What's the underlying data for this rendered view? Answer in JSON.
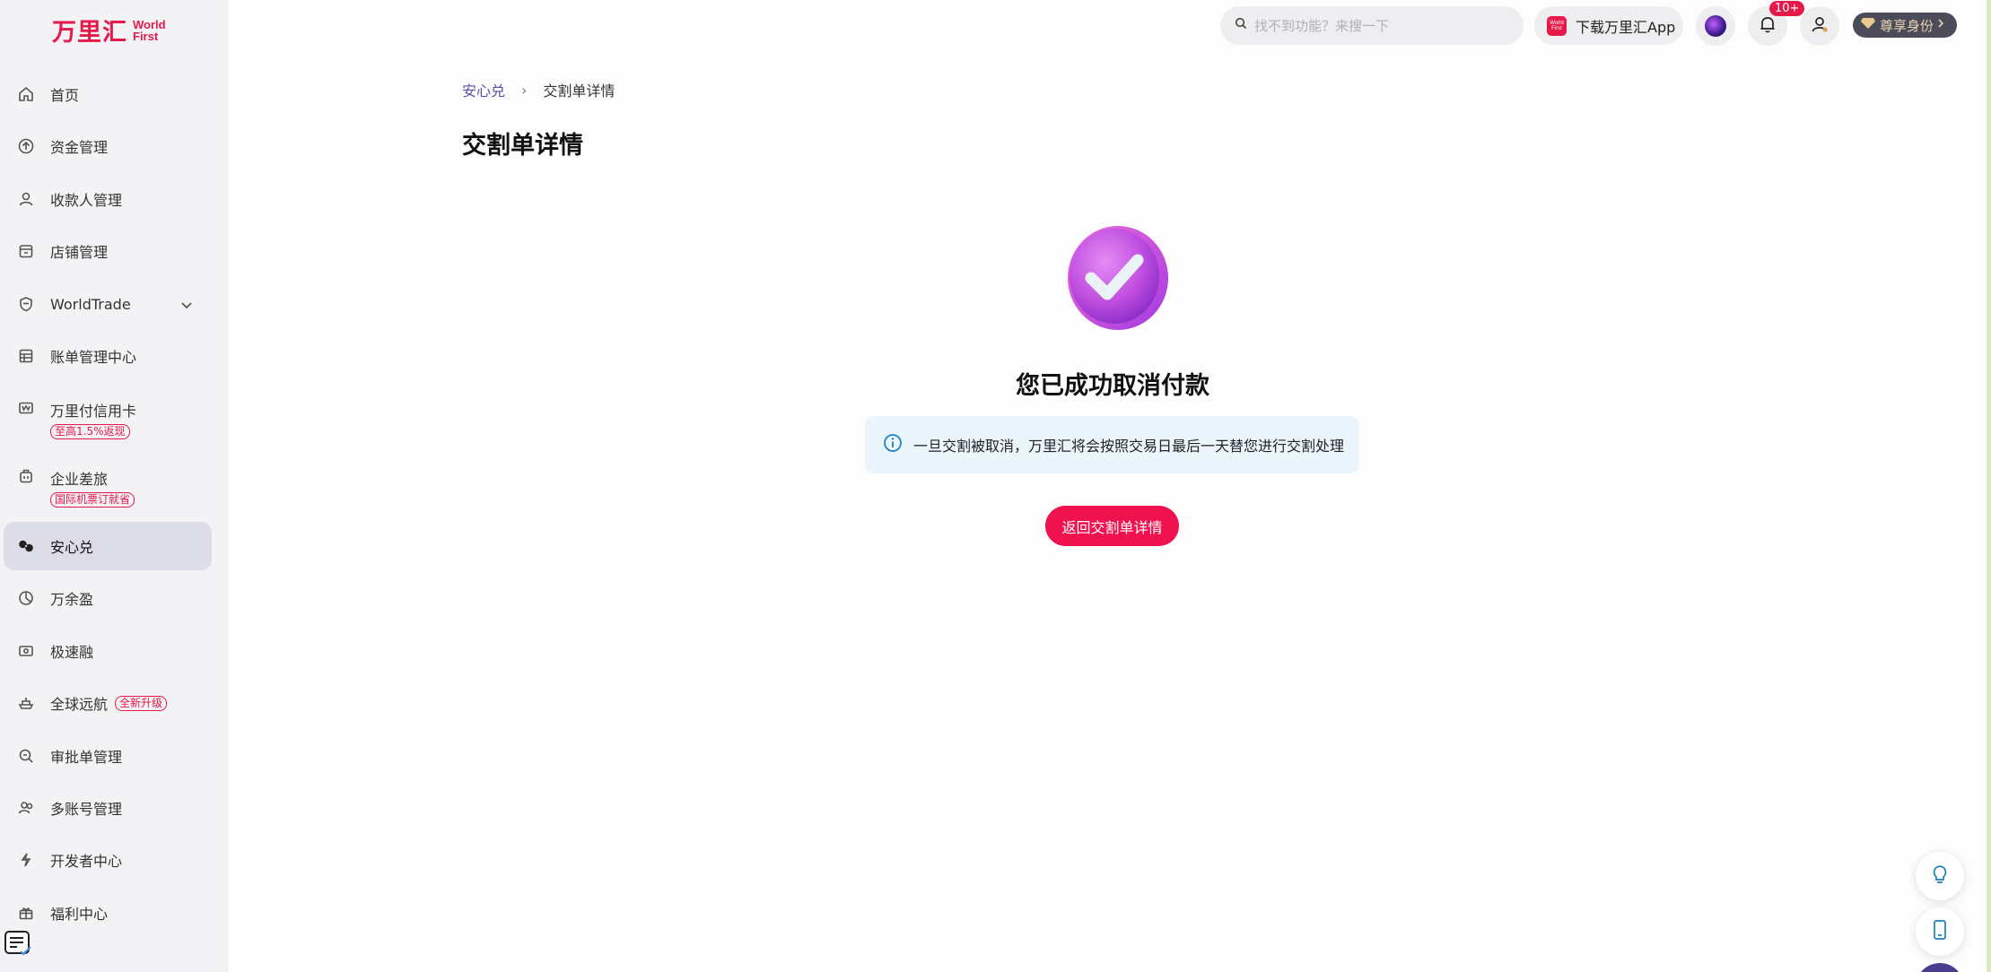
{
  "logo": {
    "cn": "万里汇",
    "en_line1": "World",
    "en_line2": "First"
  },
  "sidebar": {
    "items": [
      {
        "label": "首页",
        "icon": "home-icon"
      },
      {
        "label": "资金管理",
        "icon": "upload-circle-icon"
      },
      {
        "label": "收款人管理",
        "icon": "person-icon"
      },
      {
        "label": "店铺管理",
        "icon": "store-icon"
      },
      {
        "label": "WorldTrade",
        "icon": "shield-icon"
      },
      {
        "label": "账单管理中心",
        "icon": "table-icon"
      },
      {
        "label": "万里付信用卡",
        "badge": "至高1.5%返现",
        "icon": "card-icon"
      },
      {
        "label": "企业差旅",
        "badge": "国际机票订就省",
        "icon": "luggage-icon"
      },
      {
        "label": "安心兑",
        "icon": "exchange-icon"
      },
      {
        "label": "万余盈",
        "icon": "chart-icon"
      },
      {
        "label": "极速融",
        "icon": "money-icon"
      },
      {
        "label": "全球远航",
        "badge": "全新升级",
        "icon": "ship-icon"
      },
      {
        "label": "审批单管理",
        "icon": "search-doc-icon"
      },
      {
        "label": "多账号管理",
        "icon": "users-icon"
      },
      {
        "label": "开发者中心",
        "icon": "code-icon"
      },
      {
        "label": "福利中心",
        "icon": "gift-icon"
      }
    ]
  },
  "topbar": {
    "search_placeholder": "找不到功能？来搜一下",
    "download_label": "下载万里汇App",
    "app_icon_text": "World First",
    "notification_count": "10+",
    "vip_label": "尊享身份"
  },
  "breadcrumb": {
    "parent": "安心兑",
    "separator": "›",
    "current": "交割单详情"
  },
  "page": {
    "title": "交割单详情",
    "result_title": "您已成功取消付款",
    "notice": "一旦交割被取消，万里汇将会按照交易日最后一天替您进行交割处理",
    "return_button": "返回交割单详情"
  },
  "colors": {
    "brand": "#e5194a",
    "button": "#f0124f",
    "notice_bg": "#eaf5fc",
    "active_nav": "#dddde8"
  }
}
